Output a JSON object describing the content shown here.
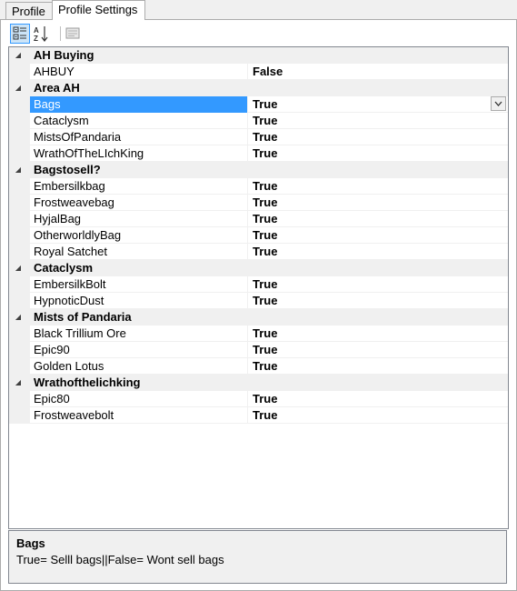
{
  "tabs": [
    {
      "label": "Profile"
    },
    {
      "label": "Profile Settings"
    }
  ],
  "toolbar": {
    "categorized_icon": "categorized-view-icon",
    "alphabetical_icon": "alphabetical-sort-icon",
    "property_pages_icon": "property-pages-icon"
  },
  "grid": {
    "categories": [
      {
        "name": "AH Buying",
        "props": [
          {
            "name": "AHBUY",
            "value": "False"
          }
        ]
      },
      {
        "name": "Area AH",
        "props": [
          {
            "name": "Bags",
            "value": "True"
          },
          {
            "name": "Cataclysm",
            "value": "True"
          },
          {
            "name": "MistsOfPandaria",
            "value": "True"
          },
          {
            "name": "WrathOfTheLIchKing",
            "value": "True"
          }
        ]
      },
      {
        "name": "Bagstosell?",
        "props": [
          {
            "name": "Embersilkbag",
            "value": "True"
          },
          {
            "name": "Frostweavebag",
            "value": "True"
          },
          {
            "name": "HyjalBag",
            "value": "True"
          },
          {
            "name": "OtherworldlyBag",
            "value": "True"
          },
          {
            "name": "Royal Satchet",
            "value": "True"
          }
        ]
      },
      {
        "name": "Cataclysm",
        "props": [
          {
            "name": "EmbersilkBolt",
            "value": "True"
          },
          {
            "name": "HypnoticDust",
            "value": "True"
          }
        ]
      },
      {
        "name": "Mists of Pandaria",
        "props": [
          {
            "name": "Black Trillium Ore",
            "value": "True"
          },
          {
            "name": "Epic90",
            "value": "True"
          },
          {
            "name": "Golden Lotus",
            "value": "True"
          }
        ]
      },
      {
        "name": "Wrathofthelichking",
        "props": [
          {
            "name": "Epic80",
            "value": "True"
          },
          {
            "name": "Frostweavebolt",
            "value": "True"
          }
        ]
      }
    ]
  },
  "help": {
    "title": "Bags",
    "description": "True= Selll bags||False= Wont sell bags"
  }
}
